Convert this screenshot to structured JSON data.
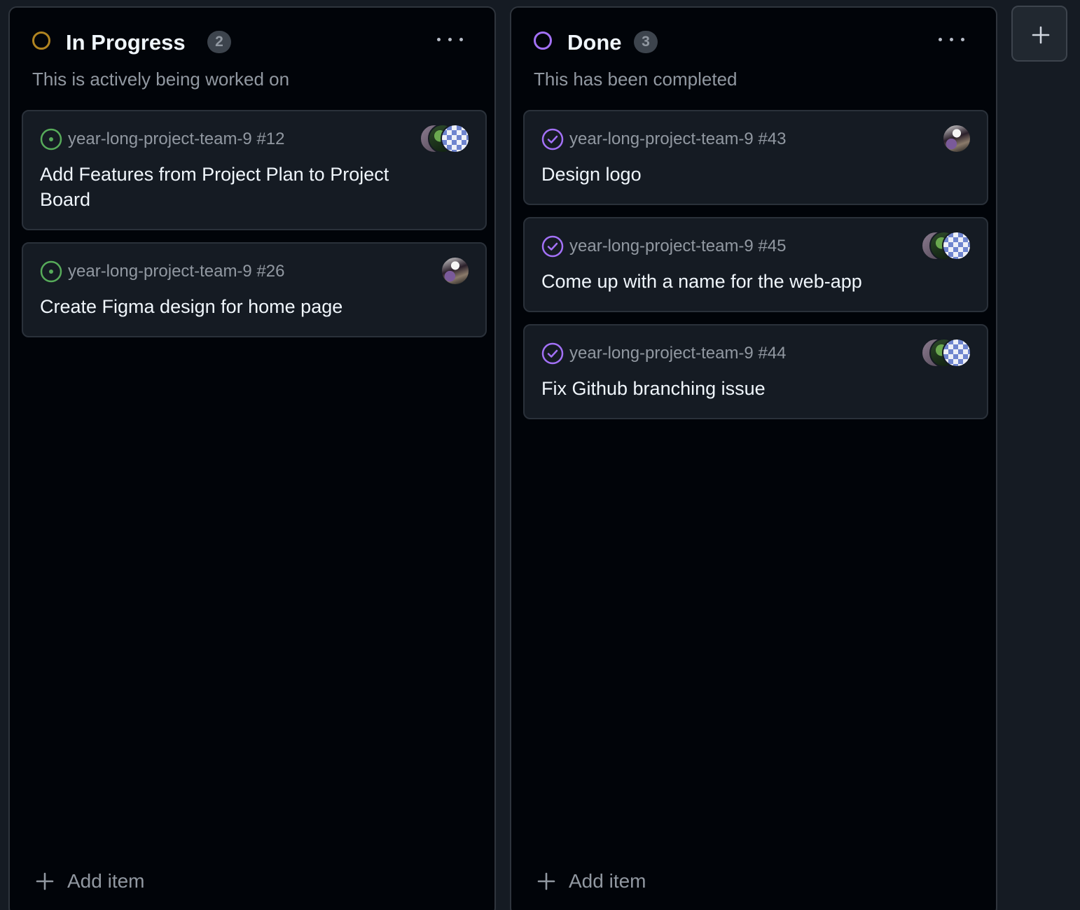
{
  "columns": [
    {
      "title": "In Progress",
      "count": "2",
      "description": "This is actively being worked on",
      "status_color": "#b08421",
      "add_item_label": "Add item",
      "cards": [
        {
          "meta": "year-long-project-team-9 #12",
          "title": "Add Features from Project Plan to Project Board",
          "state": "open",
          "avatars": [
            "mauve",
            "green",
            "checker"
          ]
        },
        {
          "meta": "year-long-project-team-9 #26",
          "title": "Create Figma design for home page",
          "state": "open",
          "avatars": [
            "photo"
          ]
        }
      ]
    },
    {
      "title": "Done",
      "count": "3",
      "description": "This has been completed",
      "status_color": "#a371f7",
      "add_item_label": "Add item",
      "cards": [
        {
          "meta": "year-long-project-team-9 #43",
          "title": "Design logo",
          "state": "closed",
          "avatars": [
            "photo"
          ]
        },
        {
          "meta": "year-long-project-team-9 #45",
          "title": "Come up with a name for the web-app",
          "state": "closed",
          "avatars": [
            "mauve",
            "green",
            "checker"
          ]
        },
        {
          "meta": "year-long-project-team-9 #44",
          "title": "Fix Github branching issue",
          "state": "closed",
          "avatars": [
            "mauve",
            "green",
            "checker"
          ]
        }
      ]
    }
  ],
  "colors": {
    "open_issue": "#57ab5a",
    "closed_issue": "#a371f7",
    "background": "#010409",
    "card": "#151b23"
  },
  "icons": {
    "open_issue": "issue-opened-icon",
    "closed_issue": "issue-closed-check-icon",
    "more": "kebab-horizontal-icon",
    "add": "plus-icon",
    "new_column": "plus-icon"
  }
}
